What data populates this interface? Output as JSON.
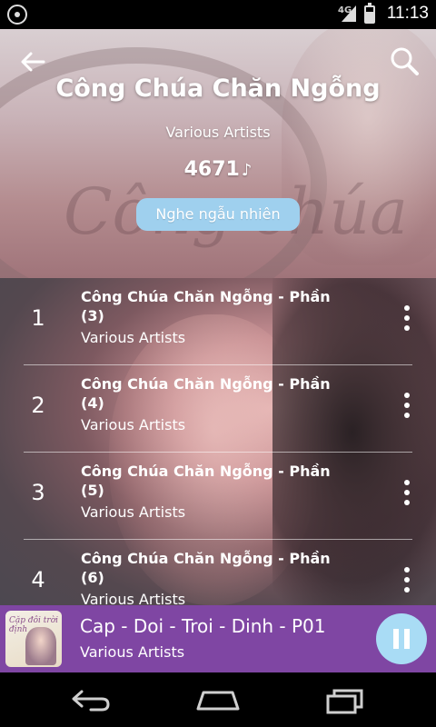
{
  "status_bar": {
    "network": "4G",
    "time": "11:13"
  },
  "header": {
    "title": "Công Chúa Chăn Ngỗng",
    "artist": "Various Artists",
    "play_count": "4671",
    "play_count_icon": "♪",
    "shuffle_label": "Nghe ngẫu nhiên"
  },
  "tracks": [
    {
      "number": "1",
      "title": "Công Chúa Chăn Ngỗng - Phần (3)",
      "artist": "Various Artists"
    },
    {
      "number": "2",
      "title": "Công Chúa Chăn Ngỗng - Phần (4)",
      "artist": "Various Artists"
    },
    {
      "number": "3",
      "title": "Công Chúa Chăn Ngỗng - Phần (5)",
      "artist": "Various Artists"
    },
    {
      "number": "4",
      "title": "Công Chúa Chăn Ngỗng - Phần (6)",
      "artist": "Various Artists"
    }
  ],
  "now_playing": {
    "title": "Cap - Doi - Troi - Dinh - P01",
    "artist": "Various Artists",
    "art_text": "Cặp đôi trời định",
    "state": "playing"
  },
  "icons": {
    "back": "arrow-left-icon",
    "search": "search-icon",
    "more": "more-vertical-icon",
    "pause": "pause-icon",
    "nav_back": "nav-back-icon",
    "nav_home": "nav-home-icon",
    "nav_recents": "nav-recents-icon"
  },
  "colors": {
    "now_playing_bar": "#7f46a3",
    "shuffle_button": "#9fd0ee",
    "pause_button": "#a9dcf5"
  }
}
